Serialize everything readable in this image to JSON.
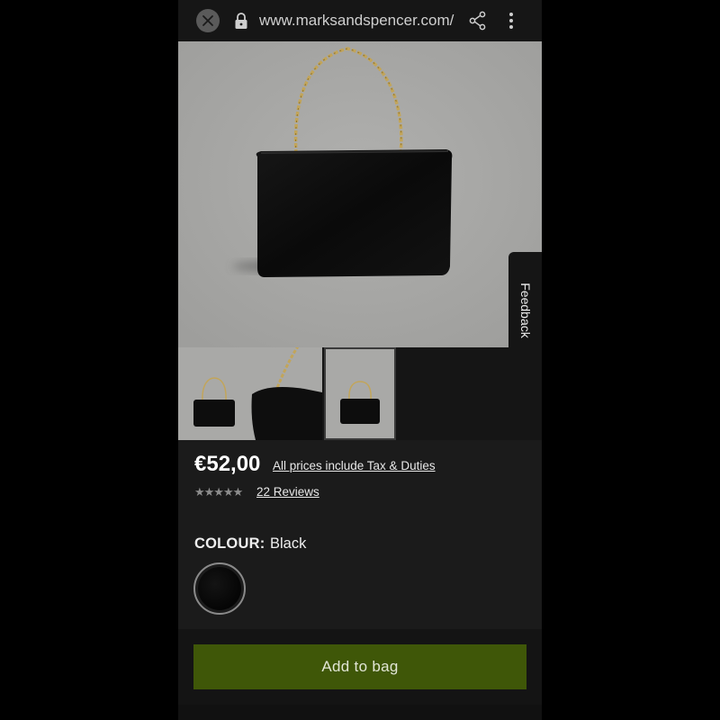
{
  "browser": {
    "url": "www.marksandspencer.com/e",
    "icons": [
      "close-icon",
      "lock-icon",
      "share-icon",
      "more-vertical-icon"
    ]
  },
  "feedback_tab": {
    "label": "Feedback"
  },
  "product": {
    "price": "€52,00",
    "tax_link": "All prices include Tax & Duties",
    "rating_stars": "★★★★★",
    "reviews_link": "22 Reviews",
    "colour_label": "COLOUR:",
    "colour_value": "Black",
    "add_to_bag_label": "Add to bag"
  },
  "colors": {
    "accent_button": "#3f5708",
    "background": "#1b1b1b",
    "image_background": "#a6a6a4"
  }
}
